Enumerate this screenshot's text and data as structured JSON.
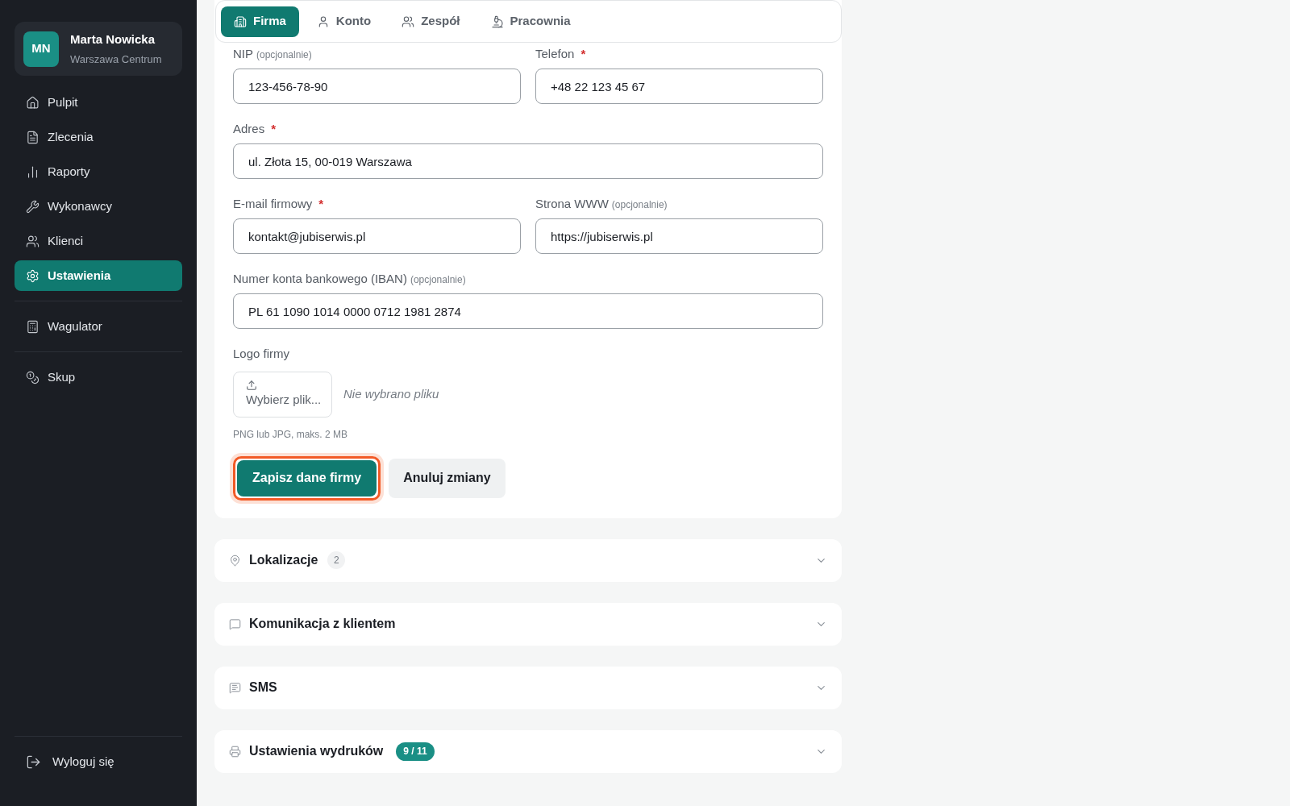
{
  "sidebar": {
    "profile": {
      "initials": "MN",
      "name": "Marta Nowicka",
      "location": "Warszawa Centrum"
    },
    "groups": [
      [
        {
          "label": "Pulpit",
          "selected": false
        },
        {
          "label": "Zlecenia",
          "selected": false
        },
        {
          "label": "Raporty",
          "selected": false
        },
        {
          "label": "Wykonawcy",
          "selected": false
        },
        {
          "label": "Klienci",
          "selected": false
        },
        {
          "label": "Ustawienia",
          "selected": true
        }
      ],
      [
        {
          "label": "Wagulator",
          "selected": false
        }
      ],
      [
        {
          "label": "Skup",
          "selected": false
        }
      ]
    ],
    "logout": "Wyloguj się"
  },
  "tabs": [
    {
      "label": "Firma",
      "selected": true
    },
    {
      "label": "Konto",
      "selected": false
    },
    {
      "label": "Zespół",
      "selected": false
    },
    {
      "label": "Pracownia",
      "selected": false
    }
  ],
  "form": {
    "rows": [
      [
        {
          "label": "NIP",
          "note": "(opcjonalnie)",
          "value": "123-456-78-90"
        },
        {
          "label": "Telefon",
          "marker": "*",
          "value": "+48 22 123 45 67"
        }
      ],
      [
        {
          "label": "Adres",
          "marker": "*",
          "value": "ul. Złota 15, 00-019 Warszawa"
        }
      ],
      [
        {
          "label": "E-mail firmowy",
          "marker": "*",
          "value": "kontakt@jubiserwis.pl"
        },
        {
          "label": "Strona WWW",
          "note": "(opcjonalnie)",
          "value": "https://jubiserwis.pl"
        }
      ],
      [
        {
          "label": "Numer konta bankowego (IBAN)",
          "note": "(opcjonalnie)",
          "value": "PL 61 1090 1014 0000 0712 1981 2874"
        }
      ]
    ],
    "logo": {
      "label": "Logo firmy",
      "button": "Wybierz plik...",
      "status": "Nie wybrano pliku",
      "hint": "PNG lub JPG, maks. 2 MB"
    },
    "save": "Zapisz dane firmy",
    "cancel": "Anuluj zmiany"
  },
  "sections": [
    {
      "title": "Lokalizacje",
      "badge": "2",
      "kind": "count",
      "expanded": false
    },
    {
      "title": "Komunikacja z klientem",
      "expanded": false
    },
    {
      "title": "SMS",
      "expanded": false
    },
    {
      "title": "Ustawienia wydruków",
      "badge": "9 / 11",
      "kind": "progress",
      "expanded": false
    }
  ]
}
